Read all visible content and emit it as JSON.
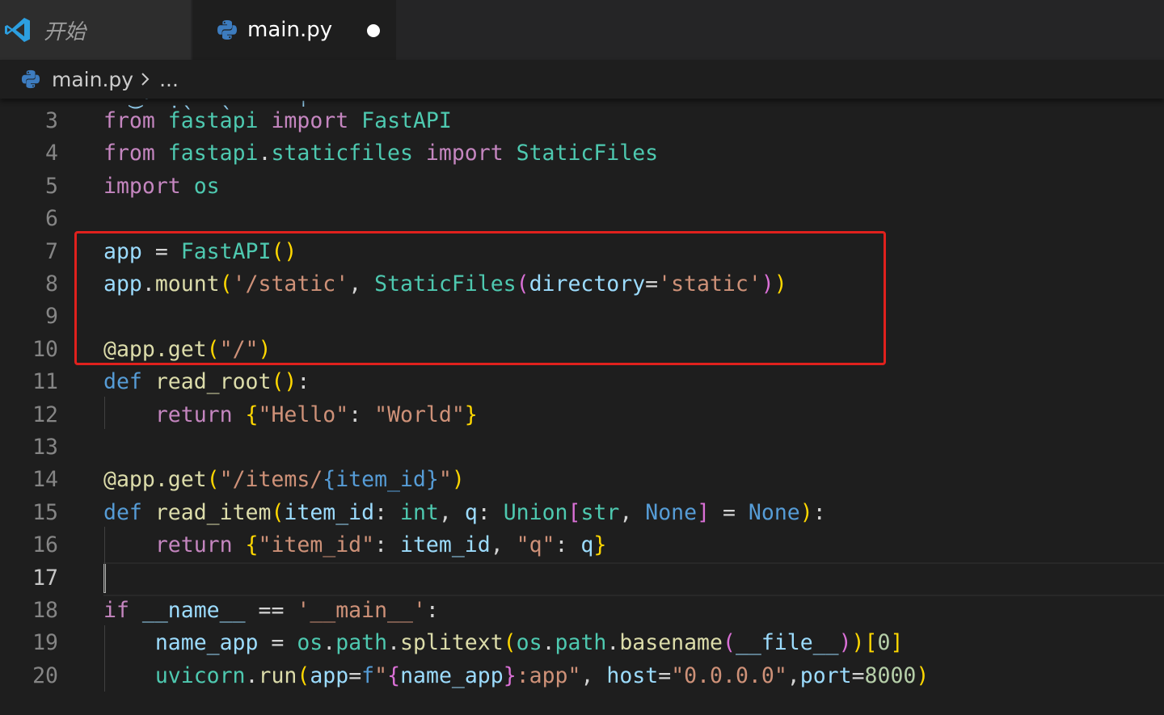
{
  "tabs": [
    {
      "label": "开始",
      "icon": "vscode-logo-icon",
      "active": false
    },
    {
      "label": "main.py",
      "icon": "python-file-icon",
      "active": true,
      "unsaved": true
    }
  ],
  "breadcrumb": {
    "file": "main.py",
    "more": "..."
  },
  "current_line": 17,
  "colors": {
    "keyword": "#c586c0",
    "module": "#4ec9b0",
    "variable": "#9cdcfe",
    "function": "#dcdcaa",
    "string": "#ce9178",
    "annotation_box": "#e0211d"
  },
  "lines": [
    {
      "num": "3",
      "tokens": [
        [
          "from",
          "kw"
        ],
        [
          " ",
          "pn"
        ],
        [
          "fastapi",
          "mod"
        ],
        [
          " ",
          "pn"
        ],
        [
          "import",
          "kw"
        ],
        [
          " ",
          "pn"
        ],
        [
          "FastAPI",
          "cls"
        ]
      ]
    },
    {
      "num": "4",
      "tokens": [
        [
          "from",
          "kw"
        ],
        [
          " ",
          "pn"
        ],
        [
          "fastapi",
          "mod"
        ],
        [
          ".",
          "pn"
        ],
        [
          "staticfiles",
          "mod"
        ],
        [
          " ",
          "pn"
        ],
        [
          "import",
          "kw"
        ],
        [
          " ",
          "pn"
        ],
        [
          "StaticFiles",
          "cls"
        ]
      ]
    },
    {
      "num": "5",
      "tokens": [
        [
          "import",
          "kw"
        ],
        [
          " ",
          "pn"
        ],
        [
          "os",
          "mod"
        ]
      ]
    },
    {
      "num": "6",
      "tokens": []
    },
    {
      "num": "7",
      "tokens": [
        [
          "app",
          "var"
        ],
        [
          " = ",
          "pn"
        ],
        [
          "FastAPI",
          "cls"
        ],
        [
          "()",
          "br1"
        ]
      ]
    },
    {
      "num": "8",
      "tokens": [
        [
          "app",
          "var"
        ],
        [
          ".",
          "pn"
        ],
        [
          "mount",
          "fn"
        ],
        [
          "(",
          "br1"
        ],
        [
          "'/static'",
          "str"
        ],
        [
          ", ",
          "pn"
        ],
        [
          "StaticFiles",
          "cls"
        ],
        [
          "(",
          "br2"
        ],
        [
          "directory",
          "var"
        ],
        [
          "=",
          "pn"
        ],
        [
          "'static'",
          "str"
        ],
        [
          ")",
          "br2"
        ],
        [
          ")",
          "br1"
        ]
      ]
    },
    {
      "num": "9",
      "tokens": []
    },
    {
      "num": "10",
      "tokens": [
        [
          "@app.get",
          "fn"
        ],
        [
          "(",
          "br1"
        ],
        [
          "\"/\"",
          "str"
        ],
        [
          ")",
          "br1"
        ]
      ]
    },
    {
      "num": "11",
      "tokens": [
        [
          "def",
          "dk"
        ],
        [
          " ",
          "pn"
        ],
        [
          "read_root",
          "fn"
        ],
        [
          "()",
          "br1"
        ],
        [
          ":",
          "pn"
        ]
      ]
    },
    {
      "num": "12",
      "tokens": [
        [
          "    ",
          "pn"
        ],
        [
          "return",
          "kw"
        ],
        [
          " ",
          "pn"
        ],
        [
          "{",
          "br1"
        ],
        [
          "\"Hello\"",
          "str"
        ],
        [
          ": ",
          "pn"
        ],
        [
          "\"World\"",
          "str"
        ],
        [
          "}",
          "br1"
        ]
      ]
    },
    {
      "num": "13",
      "tokens": []
    },
    {
      "num": "14",
      "tokens": [
        [
          "@app.get",
          "fn"
        ],
        [
          "(",
          "br1"
        ],
        [
          "\"/items/",
          "str"
        ],
        [
          "{item_id}",
          "dk"
        ],
        [
          "\"",
          "str"
        ],
        [
          ")",
          "br1"
        ]
      ]
    },
    {
      "num": "15",
      "tokens": [
        [
          "def",
          "dk"
        ],
        [
          " ",
          "pn"
        ],
        [
          "read_item",
          "fn"
        ],
        [
          "(",
          "br1"
        ],
        [
          "item_id",
          "var"
        ],
        [
          ": ",
          "pn"
        ],
        [
          "int",
          "cls"
        ],
        [
          ", ",
          "pn"
        ],
        [
          "q",
          "var"
        ],
        [
          ": ",
          "pn"
        ],
        [
          "Union",
          "cls"
        ],
        [
          "[",
          "br2"
        ],
        [
          "str",
          "cls"
        ],
        [
          ", ",
          "pn"
        ],
        [
          "None",
          "dk"
        ],
        [
          "]",
          "br2"
        ],
        [
          " = ",
          "pn"
        ],
        [
          "None",
          "dk"
        ],
        [
          ")",
          "br1"
        ],
        [
          ":",
          "pn"
        ]
      ]
    },
    {
      "num": "16",
      "tokens": [
        [
          "    ",
          "pn"
        ],
        [
          "return",
          "kw"
        ],
        [
          " ",
          "pn"
        ],
        [
          "{",
          "br1"
        ],
        [
          "\"item_id\"",
          "str"
        ],
        [
          ": ",
          "pn"
        ],
        [
          "item_id",
          "var"
        ],
        [
          ", ",
          "pn"
        ],
        [
          "\"q\"",
          "str"
        ],
        [
          ": ",
          "pn"
        ],
        [
          "q",
          "var"
        ],
        [
          "}",
          "br1"
        ]
      ]
    },
    {
      "num": "17",
      "tokens": []
    },
    {
      "num": "18",
      "tokens": [
        [
          "if",
          "kw"
        ],
        [
          " ",
          "pn"
        ],
        [
          "__name__",
          "var"
        ],
        [
          " == ",
          "pn"
        ],
        [
          "'__main__'",
          "str"
        ],
        [
          ":",
          "pn"
        ]
      ]
    },
    {
      "num": "19",
      "tokens": [
        [
          "    ",
          "pn"
        ],
        [
          "name_app",
          "var"
        ],
        [
          " = ",
          "pn"
        ],
        [
          "os",
          "mod"
        ],
        [
          ".",
          "pn"
        ],
        [
          "path",
          "mod"
        ],
        [
          ".",
          "pn"
        ],
        [
          "splitext",
          "fn"
        ],
        [
          "(",
          "br1"
        ],
        [
          "os",
          "mod"
        ],
        [
          ".",
          "pn"
        ],
        [
          "path",
          "mod"
        ],
        [
          ".",
          "pn"
        ],
        [
          "basename",
          "fn"
        ],
        [
          "(",
          "br2"
        ],
        [
          "__file__",
          "var"
        ],
        [
          ")",
          "br2"
        ],
        [
          ")",
          "br1"
        ],
        [
          "[",
          "br1"
        ],
        [
          "0",
          "num"
        ],
        [
          "]",
          "br1"
        ]
      ]
    },
    {
      "num": "20",
      "tokens": [
        [
          "    ",
          "pn"
        ],
        [
          "uvicorn",
          "mod"
        ],
        [
          ".",
          "pn"
        ],
        [
          "run",
          "fn"
        ],
        [
          "(",
          "br1"
        ],
        [
          "app",
          "var"
        ],
        [
          "=",
          "pn"
        ],
        [
          "f",
          "dk"
        ],
        [
          "\"",
          "str"
        ],
        [
          "{",
          "br2"
        ],
        [
          "name_app",
          "var"
        ],
        [
          "}",
          "br2"
        ],
        [
          ":app\"",
          "str"
        ],
        [
          ", ",
          "pn"
        ],
        [
          "host",
          "var"
        ],
        [
          "=",
          "pn"
        ],
        [
          "\"0.0.0.0\"",
          "str"
        ],
        [
          ",",
          "pn"
        ],
        [
          "port",
          "var"
        ],
        [
          "=",
          "pn"
        ],
        [
          "8000",
          "num"
        ],
        [
          ")",
          "br1"
        ]
      ]
    }
  ]
}
